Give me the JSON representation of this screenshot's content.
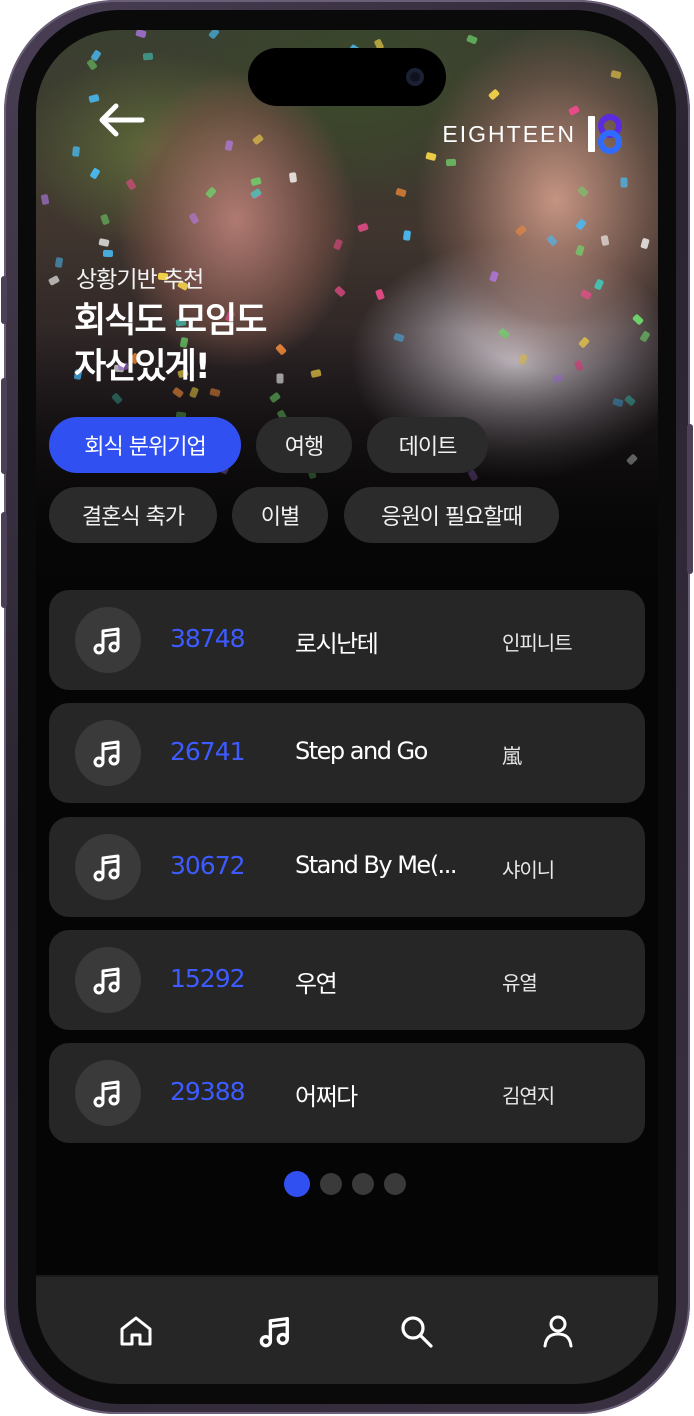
{
  "header": {
    "brand_name": "EIGHTEEN",
    "brand_mark": "18"
  },
  "hero": {
    "subtitle": "상황기반 추천",
    "title_line1": "회식도 모임도",
    "title_line2": "자신있게!"
  },
  "categories": [
    {
      "label": "회식 분위기업",
      "active": true
    },
    {
      "label": "여행",
      "active": false
    },
    {
      "label": "데이트",
      "active": false
    },
    {
      "label": "결혼식 축가",
      "active": false
    },
    {
      "label": "이별",
      "active": false
    },
    {
      "label": "응원이 필요할때",
      "active": false
    }
  ],
  "songs": [
    {
      "number": "38748",
      "title": "로시난테",
      "artist": "인피니트"
    },
    {
      "number": "26741",
      "title": "Step and Go",
      "artist": "嵐"
    },
    {
      "number": "30672",
      "title": "Stand By Me(...",
      "artist": "샤이니"
    },
    {
      "number": "15292",
      "title": "우연",
      "artist": "유열"
    },
    {
      "number": "29388",
      "title": "어쩌다",
      "artist": "김연지"
    }
  ],
  "pagination": {
    "current_page": 1,
    "total_pages": 4
  },
  "bottom_nav": [
    {
      "name": "home",
      "icon": "home-icon"
    },
    {
      "name": "songs",
      "icon": "music-note-icon"
    },
    {
      "name": "search",
      "icon": "search-icon"
    },
    {
      "name": "profile",
      "icon": "user-icon"
    }
  ],
  "colors": {
    "accent": "#3150f2",
    "song_number": "#3d5bff",
    "card_bg": "#262626",
    "chip_bg": "#2b2b2b",
    "screen_bg": "#050505"
  }
}
